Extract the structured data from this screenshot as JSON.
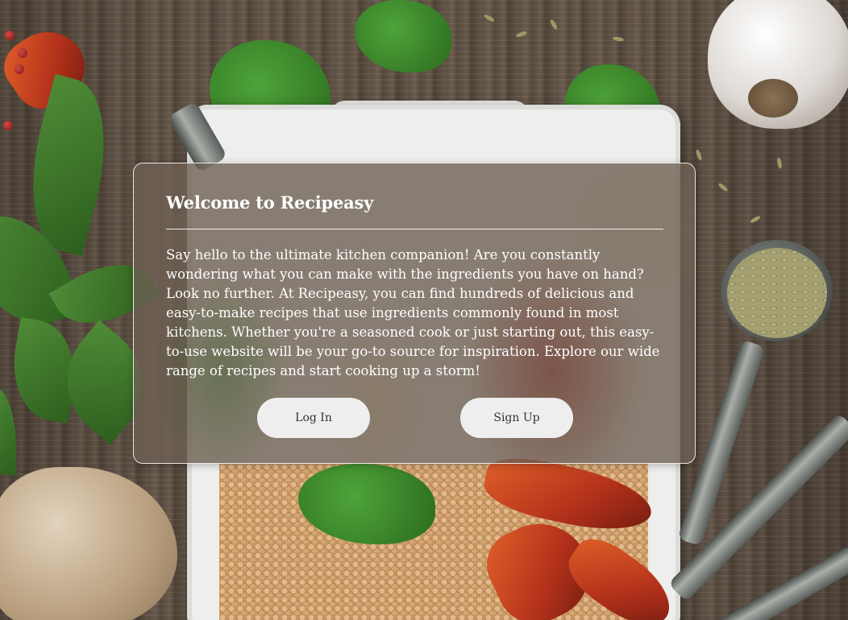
{
  "modal": {
    "title": "Welcome to Recipeasy",
    "body": "Say hello to the ultimate kitchen companion! Are you constantly wondering what you can make with the ingredients you have on hand? Look no further. At Recipeasy, you can find hundreds of delicious and easy-to-make recipes that use ingredients commonly found in most kitchens. Whether you're a seasoned cook or just starting out, this easy-to-use website will be your go-to source for inspiration. Explore our wide range of recipes and start cooking up a storm!",
    "login_label": "Log In",
    "signup_label": "Sign Up"
  },
  "colors": {
    "modal_overlay": "#6e6054",
    "button_bg": "#eeeeee",
    "button_text": "#333333",
    "text": "#ffffff"
  }
}
